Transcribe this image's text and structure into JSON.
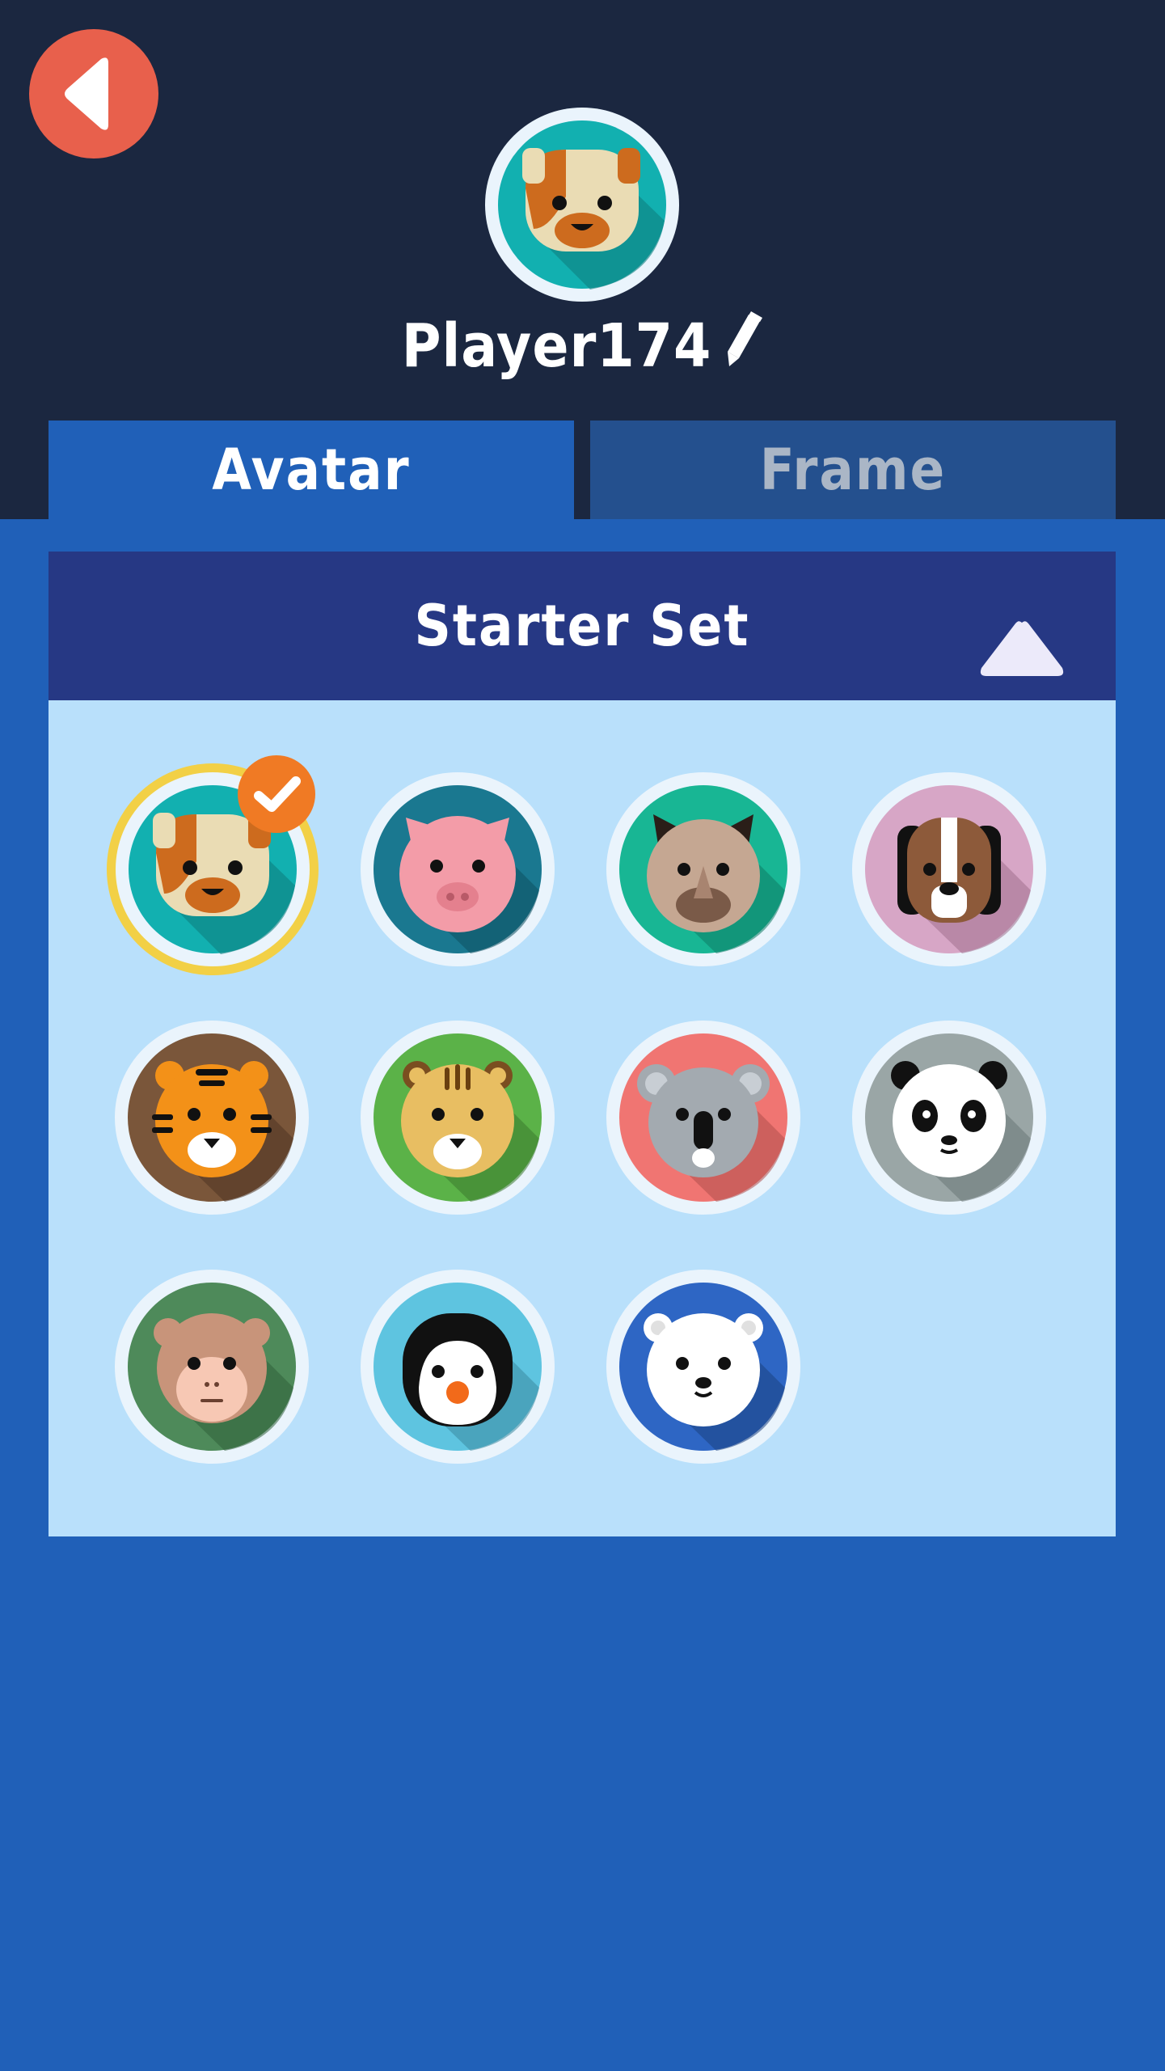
{
  "header": {
    "player_name": "Player174",
    "current_avatar": "dog"
  },
  "tabs": [
    {
      "label": "Avatar",
      "active": true
    },
    {
      "label": "Frame",
      "active": false
    }
  ],
  "section": {
    "title": "Starter Set",
    "expanded": true
  },
  "avatars": [
    {
      "name": "dog",
      "selected": true
    },
    {
      "name": "pig",
      "selected": false
    },
    {
      "name": "bat",
      "selected": false
    },
    {
      "name": "beagle",
      "selected": false
    },
    {
      "name": "tiger",
      "selected": false
    },
    {
      "name": "leopard",
      "selected": false
    },
    {
      "name": "koala",
      "selected": false
    },
    {
      "name": "panda",
      "selected": false
    },
    {
      "name": "monkey",
      "selected": false
    },
    {
      "name": "penguin",
      "selected": false
    },
    {
      "name": "polar-bear",
      "selected": false
    }
  ],
  "colors": {
    "top_bar": "#1b2740",
    "body": "#2060b8",
    "panel": "#b9e0fb",
    "panel_header": "#263884",
    "back_button": "#e8604c",
    "selected_ring": "#f2d046",
    "check_badge": "#f07a24"
  }
}
